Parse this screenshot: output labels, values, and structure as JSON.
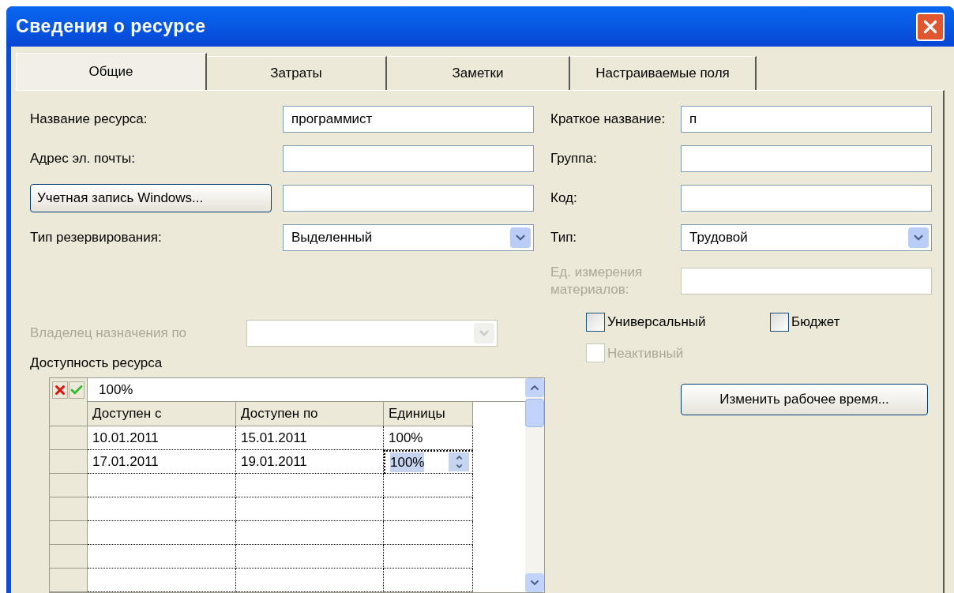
{
  "window": {
    "title": "Сведения о ресурсе"
  },
  "tabs": [
    {
      "label": "Общие",
      "selected": true
    },
    {
      "label": "Затраты",
      "selected": false
    },
    {
      "label": "Заметки",
      "selected": false
    },
    {
      "label": "Настраиваемые поля",
      "selected": false
    }
  ],
  "left_fields": [
    {
      "kind": "text",
      "label": "Название ресурса:",
      "value": "программист",
      "disabled": false
    },
    {
      "kind": "text",
      "label": "Адрес эл. почты:",
      "disabled": false
    },
    {
      "kind": "button",
      "label": "Учетная запись Windows...",
      "disabled": false
    },
    {
      "kind": "combo",
      "label": "Тип резервирования:",
      "value": "Выделенный",
      "disabled": false
    }
  ],
  "owner_field": {
    "kind": "combo",
    "label": "Владелец назначения по",
    "disabled": true
  },
  "right_fields": [
    {
      "kind": "text",
      "label": "Краткое название:",
      "value": "п",
      "disabled": false
    },
    {
      "kind": "text",
      "label": "Группа:",
      "disabled": false
    },
    {
      "kind": "text",
      "label": "Код:",
      "disabled": false
    },
    {
      "kind": "combo",
      "label": "Тип:",
      "value": "Трудовой",
      "disabled": false
    },
    {
      "kind": "text",
      "label": "Ед. измерения материалов:",
      "disabled": true
    }
  ],
  "checkboxes": [
    {
      "label": "Универсальный",
      "checked": false,
      "disabled": false
    },
    {
      "label": "Бюджет",
      "checked": false,
      "disabled": false
    },
    {
      "label": "Неактивный",
      "checked": false,
      "disabled": true
    }
  ],
  "working_time_button": "Изменить рабочее время...",
  "availability": {
    "label": "Доступность ресурса",
    "entry_value": "100%",
    "columns": [
      "Доступен с",
      "Доступен по",
      "Единицы"
    ],
    "rows": [
      {
        "cells": [
          {
            "text": "10.01.2011",
            "selected": false
          },
          {
            "text": "15.01.2011",
            "selected": false
          },
          {
            "text": "100%",
            "selected": false
          }
        ]
      },
      {
        "cells": [
          {
            "text": "17.01.2011",
            "selected": false
          },
          {
            "text": "19.01.2011",
            "selected": false
          },
          {
            "text": "100%",
            "selected": true
          }
        ]
      }
    ]
  }
}
